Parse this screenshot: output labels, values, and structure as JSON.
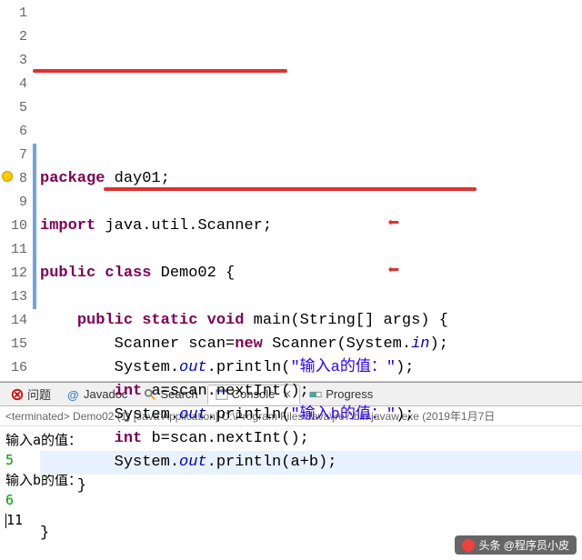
{
  "code": {
    "lines": [
      {
        "n": 1,
        "segs": [
          {
            "t": "package ",
            "c": "kw"
          },
          {
            "t": "day01;",
            "c": "plain"
          }
        ]
      },
      {
        "n": 2,
        "segs": []
      },
      {
        "n": 3,
        "segs": [
          {
            "t": "import ",
            "c": "kw"
          },
          {
            "t": "java.util.Scanner;",
            "c": "plain"
          }
        ]
      },
      {
        "n": 4,
        "segs": []
      },
      {
        "n": 5,
        "segs": [
          {
            "t": "public class ",
            "c": "kw"
          },
          {
            "t": "Demo02 {",
            "c": "plain"
          }
        ]
      },
      {
        "n": 6,
        "segs": []
      },
      {
        "n": 7,
        "segs": [
          {
            "t": "    ",
            "c": "plain"
          },
          {
            "t": "public static void ",
            "c": "kw"
          },
          {
            "t": "main(String[] args) {",
            "c": "plain"
          }
        ]
      },
      {
        "n": 8,
        "segs": [
          {
            "t": "        Scanner scan=",
            "c": "plain"
          },
          {
            "t": "new ",
            "c": "kw"
          },
          {
            "t": "Scanner(System.",
            "c": "plain"
          },
          {
            "t": "in",
            "c": "fld"
          },
          {
            "t": ");",
            "c": "plain"
          }
        ]
      },
      {
        "n": 9,
        "segs": [
          {
            "t": "        System.",
            "c": "plain"
          },
          {
            "t": "out",
            "c": "fld"
          },
          {
            "t": ".println(",
            "c": "plain"
          },
          {
            "t": "\"输入a的值：\"",
            "c": "str"
          },
          {
            "t": ");",
            "c": "plain"
          }
        ]
      },
      {
        "n": 10,
        "segs": [
          {
            "t": "        ",
            "c": "plain"
          },
          {
            "t": "int ",
            "c": "kw"
          },
          {
            "t": "a=scan.nextInt();",
            "c": "plain"
          }
        ]
      },
      {
        "n": 11,
        "segs": [
          {
            "t": "        System.",
            "c": "plain"
          },
          {
            "t": "out",
            "c": "fld"
          },
          {
            "t": ".println(",
            "c": "plain"
          },
          {
            "t": "\"输入b的值：\"",
            "c": "str"
          },
          {
            "t": ");",
            "c": "plain"
          }
        ]
      },
      {
        "n": 12,
        "segs": [
          {
            "t": "        ",
            "c": "plain"
          },
          {
            "t": "int ",
            "c": "kw"
          },
          {
            "t": "b=scan.nextInt();",
            "c": "plain"
          }
        ]
      },
      {
        "n": 13,
        "segs": [
          {
            "t": "        System.",
            "c": "plain"
          },
          {
            "t": "out",
            "c": "fld"
          },
          {
            "t": ".println(a+b);",
            "c": "plain"
          }
        ],
        "hl": true
      },
      {
        "n": 14,
        "segs": [
          {
            "t": "    }",
            "c": "plain"
          }
        ]
      },
      {
        "n": 15,
        "segs": []
      },
      {
        "n": 16,
        "segs": [
          {
            "t": "}",
            "c": "plain"
          }
        ]
      }
    ]
  },
  "tabs": {
    "problems": "问题",
    "javadoc": "Javadoc",
    "search": "Search",
    "console": "Console",
    "progress": "Progress"
  },
  "terminated": "<terminated> Demo02 (1) [Java Application] C:\\Program Files\\Java\\jre7\\bin\\javaw.exe (2019年1月7日",
  "console": {
    "l1": "输入a的值：",
    "l2": "5",
    "l3": "输入b的值：",
    "l4": "6",
    "l5": "11"
  },
  "watermark": "头条 @程序员小皮"
}
